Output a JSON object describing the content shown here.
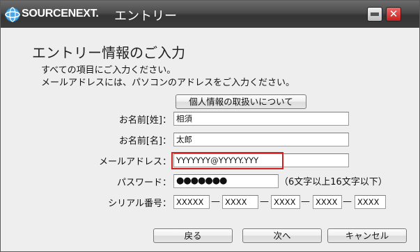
{
  "titlebar": {
    "brand": "SOURCENEXT.",
    "title": "エントリー"
  },
  "heading": "エントリー情報のご入力",
  "instructions": [
    "すべての項目にご入力ください。",
    "メールアドレスには、パソコンのアドレスをご入力ください。"
  ],
  "privacy_button": "個人情報の取扱いについて",
  "fields": {
    "last_name": {
      "label": "お名前[姓]：",
      "value": "相須"
    },
    "first_name": {
      "label": "お名前[名]：",
      "value": "太郎"
    },
    "email": {
      "label": "メールアドレス：",
      "value": "YYYYYYY@YYYYY.YYY"
    },
    "password": {
      "label": "パスワード：",
      "value": "●●●●●●●",
      "hint": "（6文字以上16文字以下）"
    },
    "serial": {
      "label": "シリアル番号：",
      "parts": [
        "XXXXX",
        "XXXX",
        "XXXX",
        "XXXX",
        "XXXX"
      ],
      "separator": "—"
    }
  },
  "buttons": {
    "back": "戻る",
    "next": "次へ",
    "cancel": "キャンセル"
  },
  "colors": {
    "highlight": "#d02020",
    "titlebar": "#3d3d3d",
    "close_button": "#c4201e"
  }
}
